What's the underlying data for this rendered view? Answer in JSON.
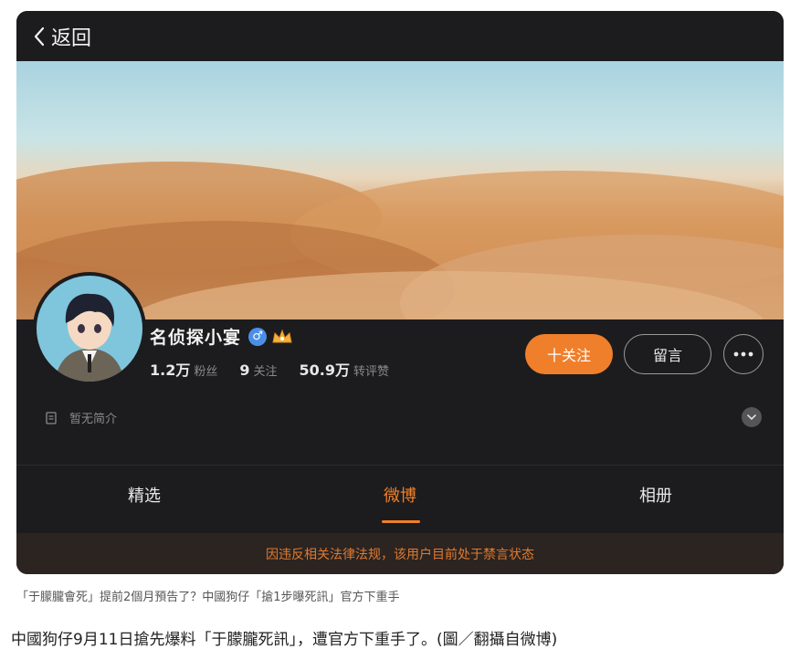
{
  "header": {
    "back_label": "返回"
  },
  "profile": {
    "name": "名侦探小宴",
    "gender_symbol": "♂",
    "stats": [
      {
        "value": "1.2万",
        "label": "粉丝"
      },
      {
        "value": "9",
        "label": "关注"
      },
      {
        "value": "50.9万",
        "label": "转评赞"
      }
    ],
    "bio": "暂无简介"
  },
  "actions": {
    "follow_label": "十关注",
    "message_label": "留言"
  },
  "tabs": [
    {
      "label": "精选"
    },
    {
      "label": "微博",
      "active": true
    },
    {
      "label": "相册"
    }
  ],
  "notice": "因违反相关法律法规，该用户目前处于禁言状态",
  "captions": {
    "small": "「于朦朧會死」提前2個月預告了？中國狗仔「搶1步曝死訊」官方下重手",
    "main": "中國狗仔9月11日搶先爆料「于朦朧死訊」，遭官方下重手了。(圖／翻攝自微博)"
  },
  "colors": {
    "accent": "#f07f2b",
    "background": "#1c1c1e",
    "badge_blue": "#4a8fe7"
  }
}
